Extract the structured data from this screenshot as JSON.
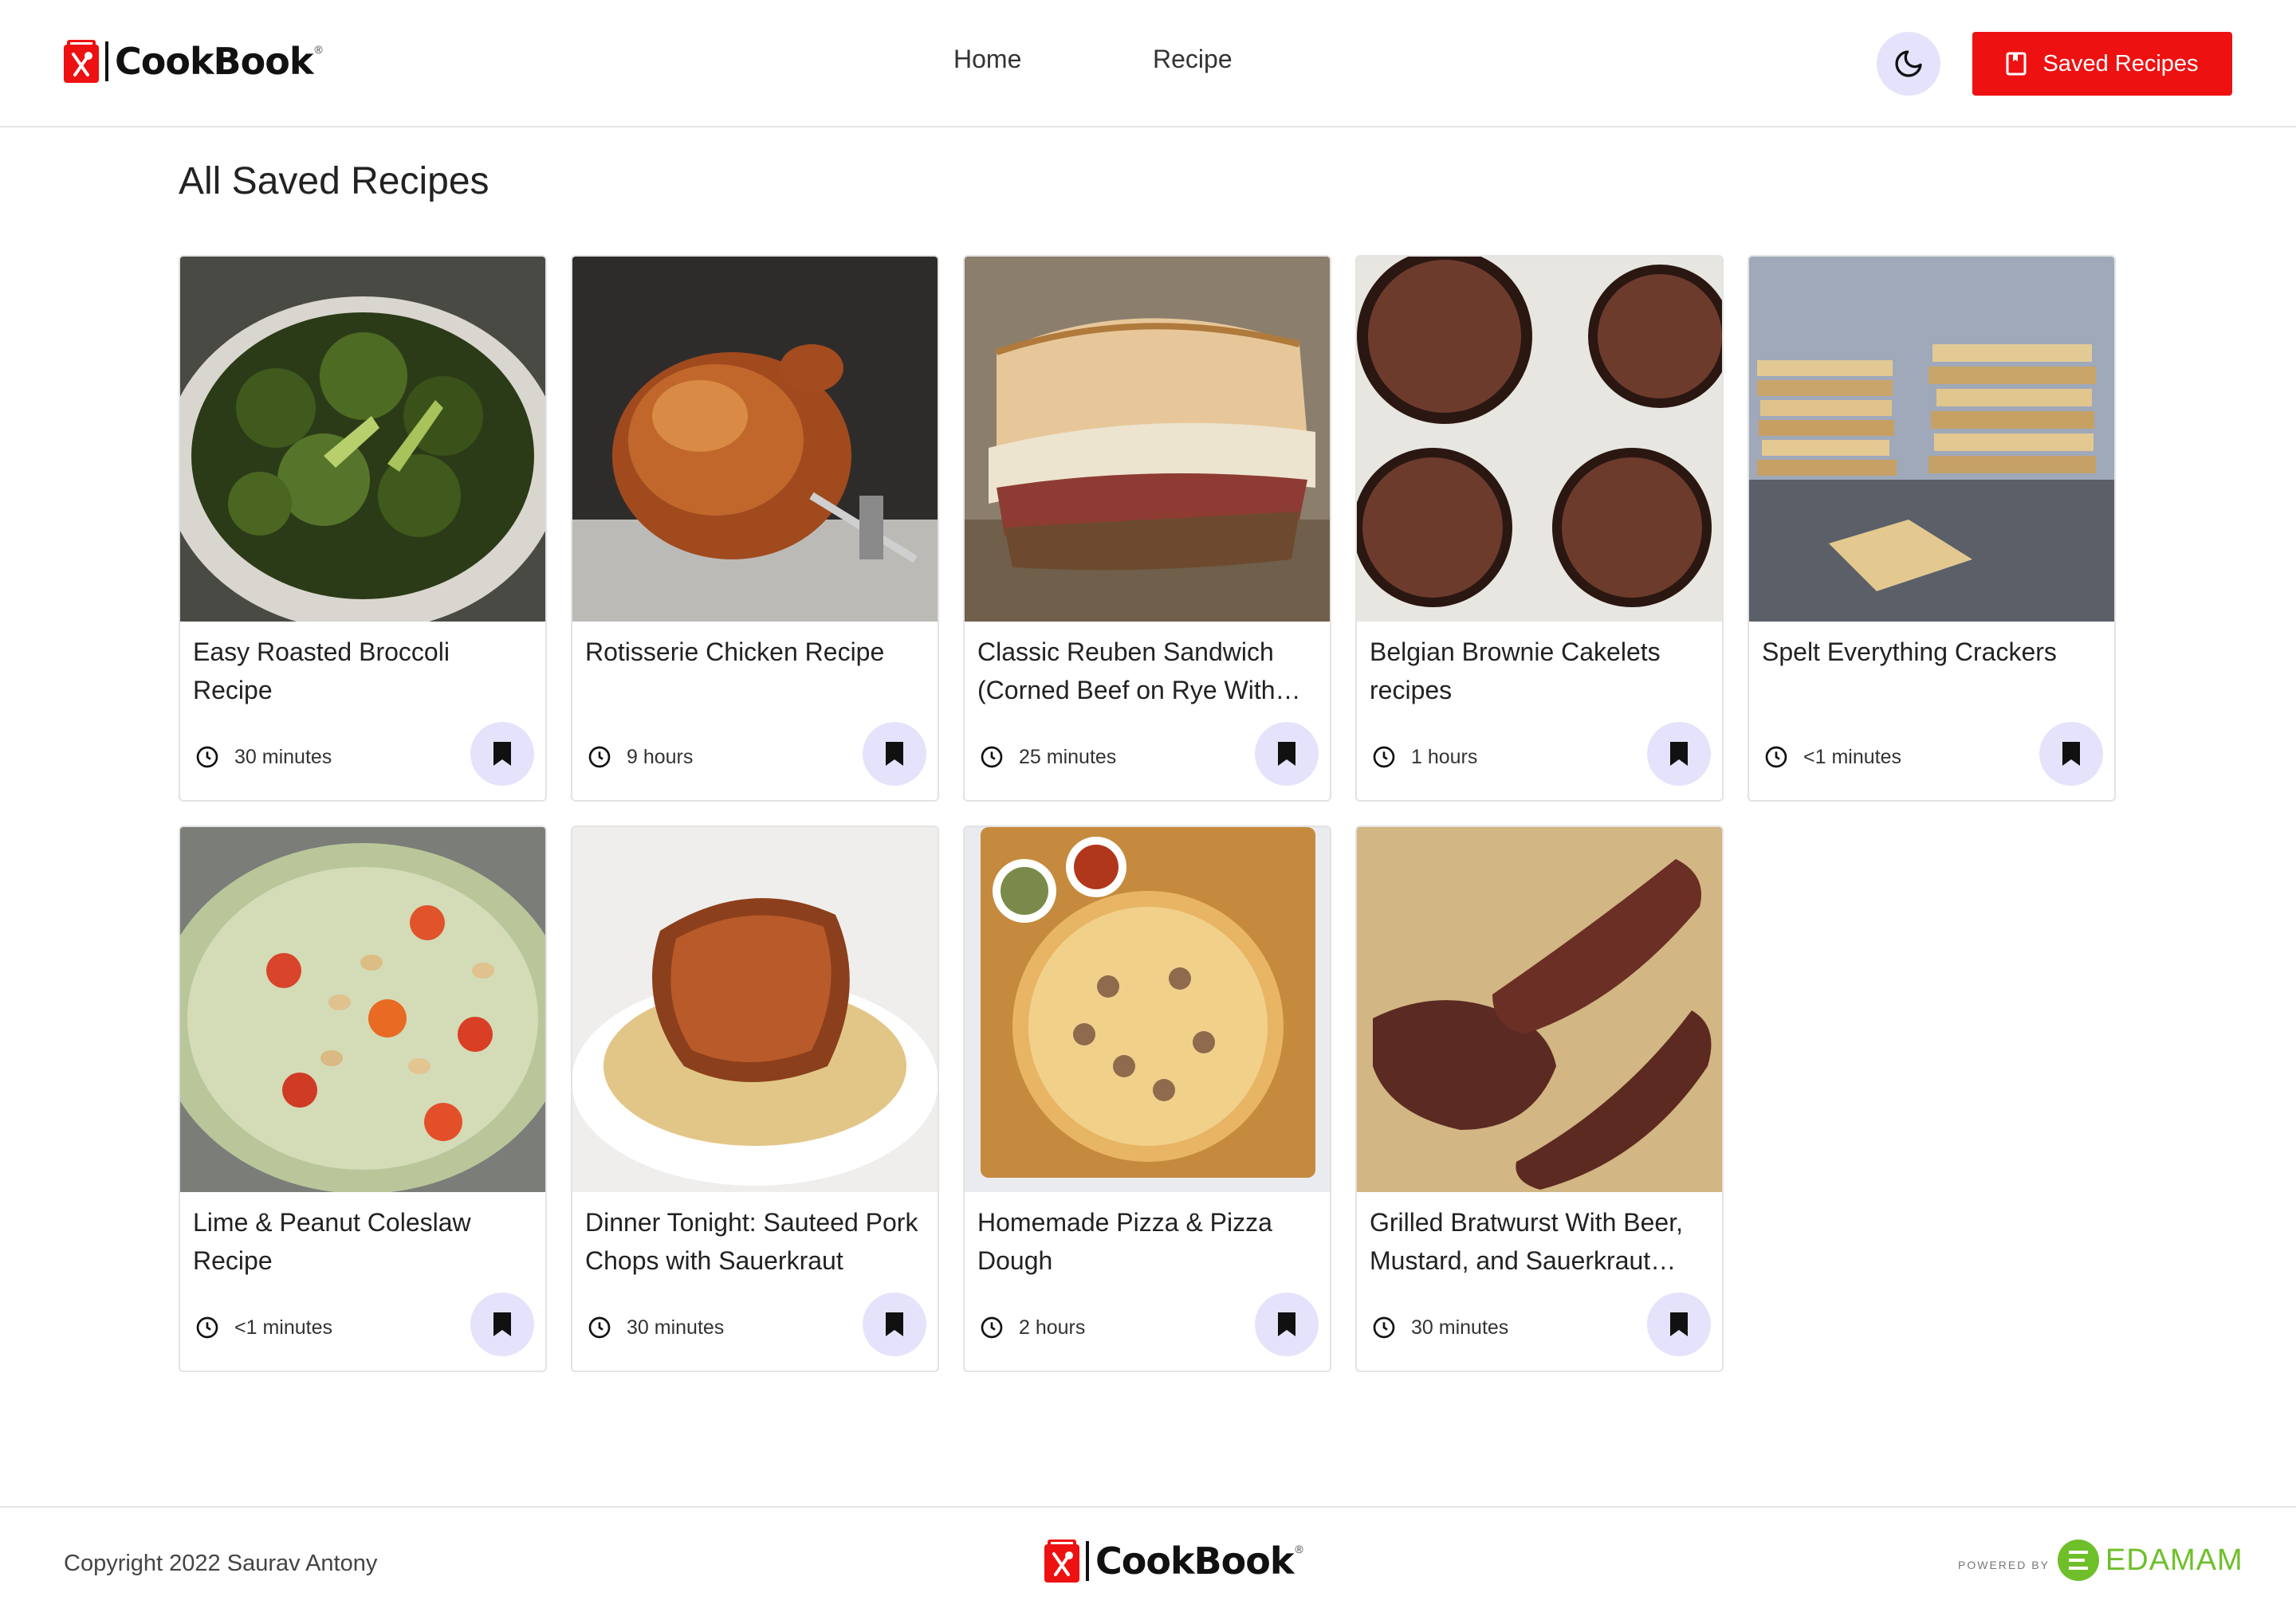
{
  "brand": {
    "name": "CookBook",
    "reg": "®",
    "color": "#ee1111"
  },
  "nav": {
    "home": "Home",
    "recipe": "Recipe"
  },
  "header": {
    "theme_icon": "moon-icon",
    "saved_button": "Saved Recipes"
  },
  "page": {
    "title": "All Saved Recipes"
  },
  "recipes": [
    {
      "title": "Easy Roasted Broccoli Recipe",
      "time": "30 minutes"
    },
    {
      "title": "Rotisserie Chicken Recipe",
      "time": "9 hours"
    },
    {
      "title": "Classic Reuben Sandwich (Corned Beef on Rye With Sauerkraut)",
      "time": "25 minutes"
    },
    {
      "title": "Belgian Brownie Cakelets recipes",
      "time": "1 hours"
    },
    {
      "title": "Spelt Everything Crackers",
      "time": "<1 minutes"
    },
    {
      "title": "Lime & Peanut Coleslaw Recipe",
      "time": "<1 minutes"
    },
    {
      "title": "Dinner Tonight: Sauteed Pork Chops with Sauerkraut",
      "time": "30 minutes"
    },
    {
      "title": "Homemade Pizza & Pizza Dough",
      "time": "2 hours"
    },
    {
      "title": "Grilled Bratwurst With Beer, Mustard, and Sauerkraut Recipe",
      "time": "30 minutes"
    }
  ],
  "footer": {
    "copyright": "Copyright 2022 Saurav Antony",
    "powered_by": "POWERED BY",
    "edamam": "EDAMAM"
  },
  "colors": {
    "accent_light": "#e4e3fb",
    "edamam_green": "#6fbf2a"
  }
}
